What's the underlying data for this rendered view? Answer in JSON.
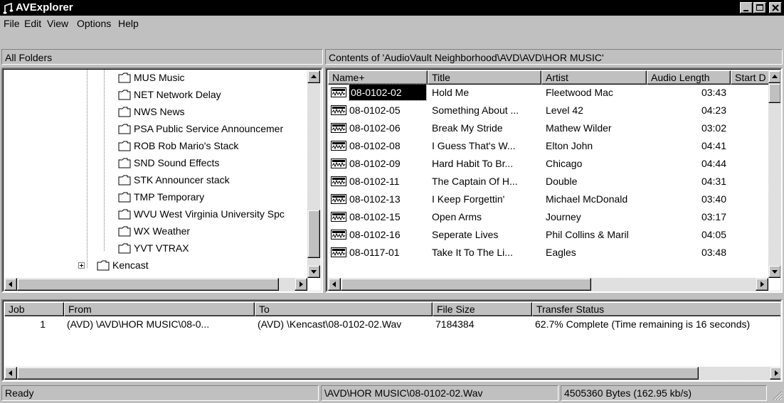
{
  "window": {
    "title": "AVExplorer"
  },
  "menu": {
    "file": "File",
    "edit": "Edit",
    "view": "View",
    "options": "Options",
    "help": "Help"
  },
  "left_pane": {
    "header": "All Folders",
    "items": [
      {
        "label": "MUS Music"
      },
      {
        "label": "NET Network Delay"
      },
      {
        "label": "NWS News"
      },
      {
        "label": "PSA Public Service Announcemer"
      },
      {
        "label": "ROB Rob Mario's Stack"
      },
      {
        "label": "SND Sound Effects"
      },
      {
        "label": "STK Announcer stack"
      },
      {
        "label": "TMP Temporary"
      },
      {
        "label": "WVU West Virginia University Spc"
      },
      {
        "label": "WX Weather"
      },
      {
        "label": "YVT VTRAX"
      },
      {
        "label": "Kencast"
      }
    ]
  },
  "right_pane": {
    "header": "Contents of 'AudioVault Neighborhood\\AVD\\AVD\\HOR MUSIC'",
    "columns": [
      "Name+",
      "Title",
      "Artist",
      "Audio Length",
      "Start D"
    ],
    "rows": [
      {
        "name": "08-0102-02",
        "title": "Hold Me",
        "artist": "Fleetwood Mac",
        "length": "03:43"
      },
      {
        "name": "08-0102-05",
        "title": "Something About ...",
        "artist": "Level 42",
        "length": "04:23"
      },
      {
        "name": "08-0102-06",
        "title": "Break My Stride",
        "artist": "Mathew Wilder",
        "length": "03:02"
      },
      {
        "name": "08-0102-08",
        "title": "I Guess That's W...",
        "artist": "Elton John",
        "length": "04:41"
      },
      {
        "name": "08-0102-09",
        "title": "Hard Habit To Br...",
        "artist": "Chicago",
        "length": "04:44"
      },
      {
        "name": "08-0102-11",
        "title": "The Captain Of H...",
        "artist": "Double",
        "length": "04:31"
      },
      {
        "name": "08-0102-13",
        "title": "I Keep Forgettin'",
        "artist": "Michael McDonald",
        "length": "03:40"
      },
      {
        "name": "08-0102-15",
        "title": "Open Arms",
        "artist": "Journey",
        "length": "03:17"
      },
      {
        "name": "08-0102-16",
        "title": "Seperate Lives",
        "artist": "Phil Collins & Maril",
        "length": "04:05"
      },
      {
        "name": "08-0117-01",
        "title": "Take It To The Li...",
        "artist": "Eagles",
        "length": "03:48"
      }
    ]
  },
  "jobs": {
    "columns": [
      "Job",
      "From",
      "To",
      "File Size",
      "Transfer Status"
    ],
    "rows": [
      {
        "job": "1",
        "from": "(AVD) \\AVD\\HOR MUSIC\\08-0...",
        "to": "(AVD) \\Kencast\\08-0102-02.Wav",
        "size": "7184384",
        "status": "62.7% Complete (Time remaining is 16 seconds)"
      }
    ]
  },
  "status_bar": {
    "state": "Ready",
    "path": "\\AVD\\HOR MUSIC\\08-0102-02.Wav",
    "transfer": "4505360 Bytes (162.95 kb/s)"
  },
  "icons": [
    "app-icon",
    "folder-icon",
    "audio-file-icon",
    "scroll-arrow-icon"
  ]
}
